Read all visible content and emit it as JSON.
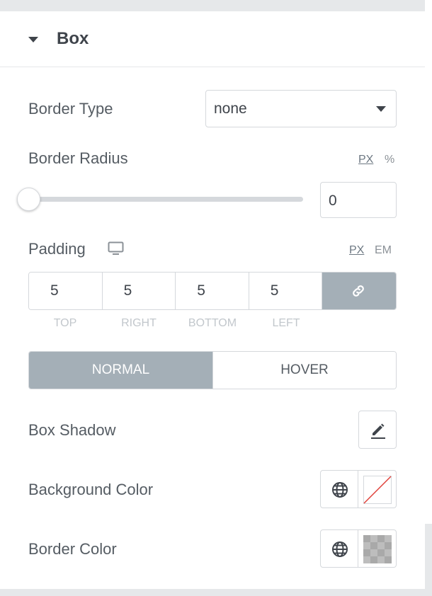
{
  "section": {
    "title": "Box"
  },
  "border_type": {
    "label": "Border Type",
    "value": "none"
  },
  "border_radius": {
    "label": "Border Radius",
    "units": [
      "PX",
      "%"
    ],
    "active_unit": "PX",
    "value": "0",
    "slider_level": 0
  },
  "padding": {
    "label": "Padding",
    "units": [
      "PX",
      "EM"
    ],
    "active_unit": "PX",
    "values": [
      "5",
      "5",
      "5",
      "5"
    ],
    "labels": [
      "TOP",
      "RIGHT",
      "BOTTOM",
      "LEFT"
    ],
    "linked": true
  },
  "tabs": [
    "NORMAL",
    "HOVER"
  ],
  "active_tab": "NORMAL",
  "box_shadow": {
    "label": "Box Shadow",
    "icon": "pencil-icon"
  },
  "background_color": {
    "label": "Background Color",
    "icons": [
      "globe-icon",
      "no-color-swatch"
    ]
  },
  "border_color": {
    "label": "Border Color",
    "icons": [
      "globe-icon",
      "transparent-swatch"
    ]
  },
  "colors": {
    "accent_gray": "#a4afb7",
    "border": "#d5d8dc",
    "text": "#555c63"
  }
}
